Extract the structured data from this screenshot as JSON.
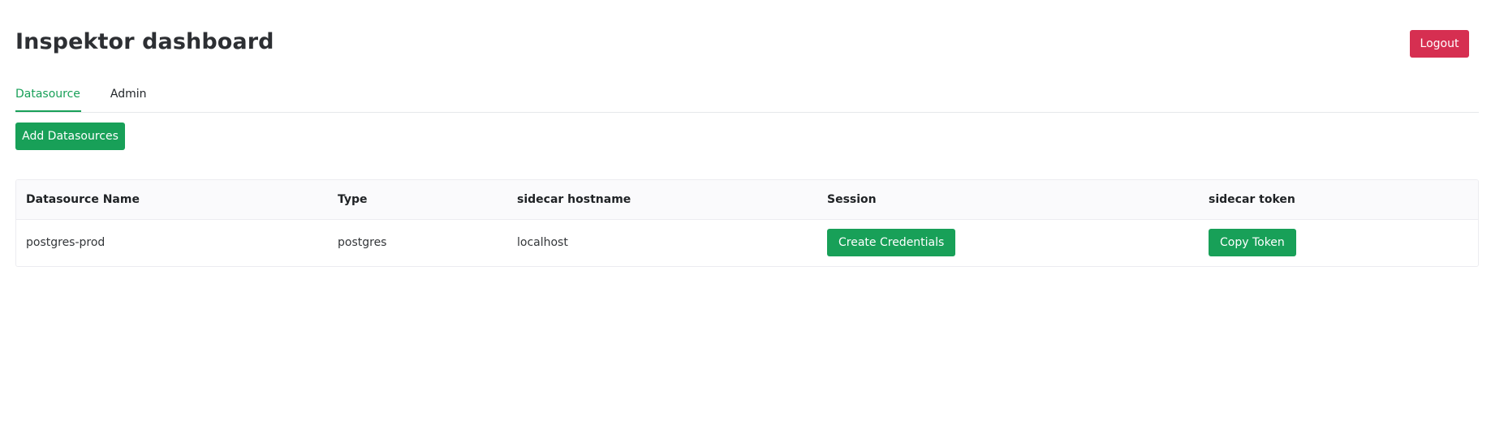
{
  "header": {
    "title": "Inspektor dashboard",
    "logout_label": "Logout"
  },
  "tabs": [
    {
      "label": "Datasource",
      "active": true
    },
    {
      "label": "Admin",
      "active": false
    }
  ],
  "toolbar": {
    "add_label": "Add Datasources"
  },
  "table": {
    "columns": [
      "Datasource Name",
      "Type",
      "sidecar hostname",
      "Session",
      "sidecar token"
    ],
    "rows": [
      {
        "name": "postgres-prod",
        "type": "postgres",
        "hostname": "localhost",
        "session_action": "Create Credentials",
        "token_action": "Copy Token"
      }
    ]
  },
  "colors": {
    "accent": "#18a058",
    "danger": "#d62f51"
  }
}
